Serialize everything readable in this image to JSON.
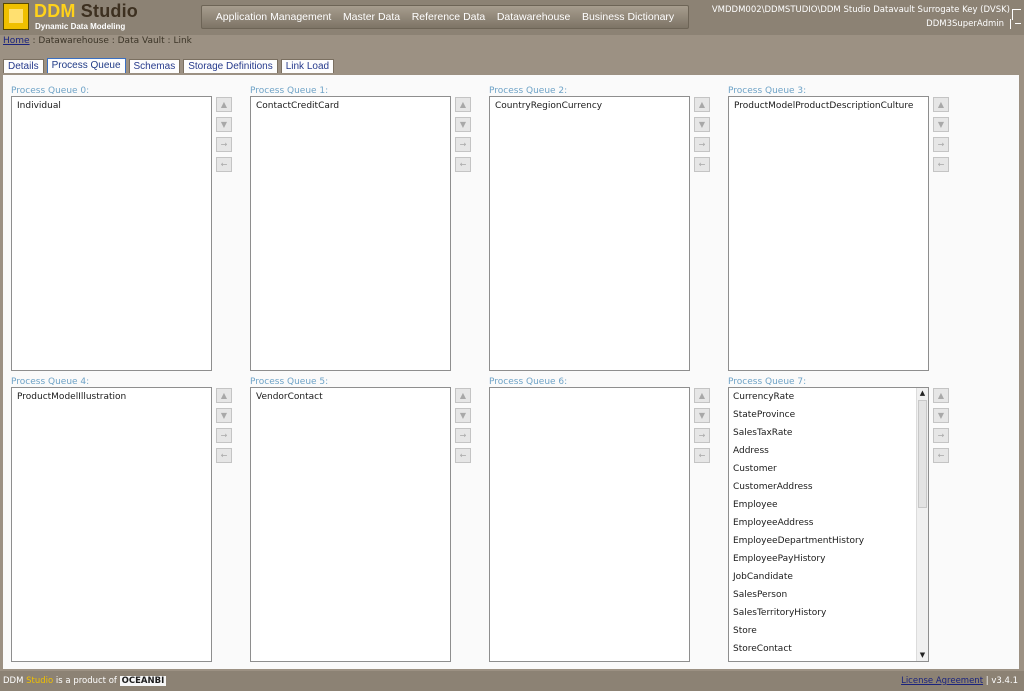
{
  "app": {
    "logo_main": "DDM",
    "logo_studio": "Studio",
    "logo_subtitle": "Dynamic Data Modeling"
  },
  "topnav": [
    "Application Management",
    "Master Data",
    "Reference Data",
    "Datawarehouse",
    "Business Dictionary"
  ],
  "header": {
    "server_info": "VMDDM002\\DDMSTUDIO\\DDM Studio Datavault Surrogate Key (DVSK)",
    "user": "DDM3SuperAdmin"
  },
  "breadcrumb": {
    "home": "Home",
    "rest": " : Datawarehouse : Data Vault : Link"
  },
  "tabs": [
    "Details",
    "Process Queue",
    "Schemas",
    "Storage Definitions",
    "Link Load"
  ],
  "active_tab": "Process Queue",
  "queues": [
    {
      "label": "Process Queue 0:",
      "items": [
        "Individual"
      ]
    },
    {
      "label": "Process Queue 1:",
      "items": [
        "ContactCreditCard"
      ]
    },
    {
      "label": "Process Queue 2:",
      "items": [
        "CountryRegionCurrency"
      ]
    },
    {
      "label": "Process Queue 3:",
      "items": [
        "ProductModelProductDescriptionCulture"
      ]
    },
    {
      "label": "Process Queue 4:",
      "items": [
        "ProductModelIllustration"
      ]
    },
    {
      "label": "Process Queue 5:",
      "items": [
        "VendorContact"
      ]
    },
    {
      "label": "Process Queue 6:",
      "items": []
    },
    {
      "label": "Process Queue 7:",
      "items": [
        "CurrencyRate",
        "StateProvince",
        "SalesTaxRate",
        "Address",
        "Customer",
        "CustomerAddress",
        "Employee",
        "EmployeeAddress",
        "EmployeeDepartmentHistory",
        "EmployeePayHistory",
        "JobCandidate",
        "SalesPerson",
        "SalesTerritoryHistory",
        "Store",
        "StoreContact"
      ]
    }
  ],
  "footer": {
    "prefix": "DDM ",
    "studio": "Studio",
    "product_of": " is a product of ",
    "company": "OCEANBI",
    "license": "License Agreement",
    "version": "v3.4.1"
  }
}
